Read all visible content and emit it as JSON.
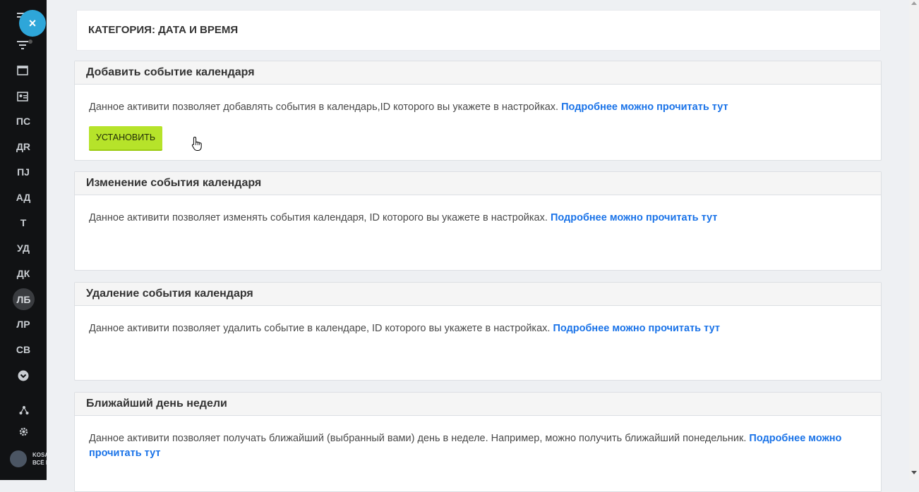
{
  "sidebar": {
    "close_icon": "×",
    "items": [
      "ПС",
      "ДR",
      "ПJ",
      "АД",
      "Т",
      "УД",
      "ДК",
      "ЛБ",
      "ЛР",
      "СВ"
    ],
    "brand_line1": "KOSA",
    "brand_line2": "ВСЁ Б"
  },
  "page": {
    "header_title": "КАТЕГОРИЯ: ДАТА И ВРЕМЯ"
  },
  "panels": [
    {
      "title": "Добавить событие календаря",
      "text": "Данное активити позволяет добавлять события в календарь,ID которого вы укажете в настройках.",
      "link": "Подробнее можно прочитать тут",
      "button": "УСТАНОВИТЬ"
    },
    {
      "title": "Изменение события календаря",
      "text": "Данное активити позволяет изменять события календаря, ID которого вы укажете в настройках.",
      "link": "Подробнее можно прочитать тут"
    },
    {
      "title": "Удаление события календаря",
      "text": "Данное активити позволяет удалить событие в календаре, ID которого вы укажете в настройках.",
      "link": "Подробнее можно прочитать тут"
    },
    {
      "title": "Ближайший день недели",
      "text": "Данное активити позволяет получать ближайший (выбранный вами) день в неделе. Например, можно получить ближайший понедельник.",
      "link": "Подробнее можно прочитать тут"
    }
  ]
}
